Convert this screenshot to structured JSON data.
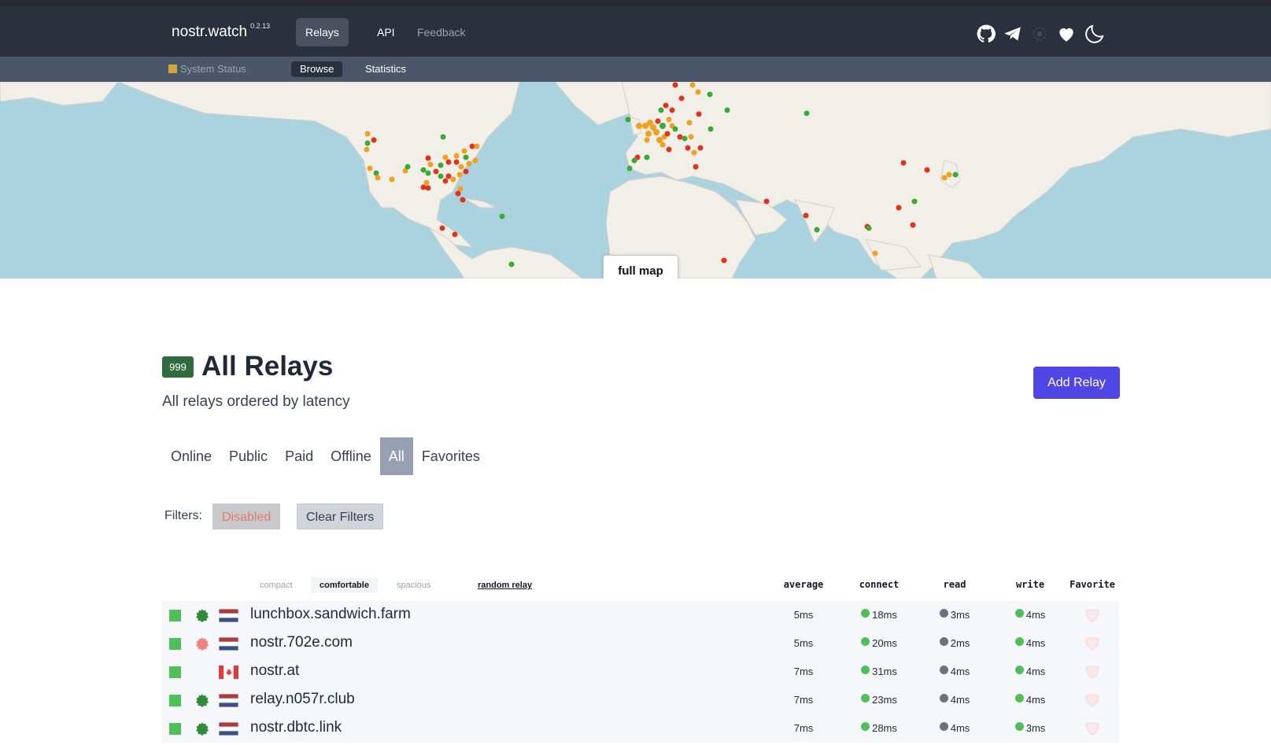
{
  "nav": {
    "brand": "nostr.watch",
    "version": "0.2.13",
    "items": [
      {
        "label": "Relays",
        "active": true
      },
      {
        "label": "API",
        "active": false
      },
      {
        "label": "Feedback",
        "active": false
      }
    ],
    "icons": [
      "github-icon",
      "telegram-icon",
      "nostr-icon",
      "heart-icon",
      "moon-icon"
    ]
  },
  "subnav": {
    "status": "System Status",
    "browse": "Browse",
    "statistics": "Statistics"
  },
  "map": {
    "button": "full map"
  },
  "header": {
    "count": "999",
    "title": "All Relays",
    "subtitle": "All relays ordered by latency",
    "add_button": "Add Relay"
  },
  "tabs": [
    {
      "label": "Online",
      "active": false
    },
    {
      "label": "Public",
      "active": false
    },
    {
      "label": "Paid",
      "active": false
    },
    {
      "label": "Offline",
      "active": false
    },
    {
      "label": "All",
      "active": true
    },
    {
      "label": "Favorites",
      "active": false
    }
  ],
  "filters": {
    "label": "Filters:",
    "disabled": "Disabled",
    "clear": "Clear Filters"
  },
  "table": {
    "density": [
      "compact",
      "comfortable",
      "spacious"
    ],
    "density_active": "comfortable",
    "random": "random relay",
    "columns": [
      "average",
      "connect",
      "read",
      "write",
      "Favorite"
    ],
    "rows": [
      {
        "name": "lunchbox.sandwich.farm",
        "seal": "green",
        "flag": "nl",
        "average": "5ms",
        "connect": "18ms",
        "read": "3ms",
        "write": "4ms"
      },
      {
        "name": "nostr.702e.com",
        "seal": "red",
        "flag": "nl",
        "average": "5ms",
        "connect": "20ms",
        "read": "2ms",
        "write": "4ms"
      },
      {
        "name": "nostr.at",
        "seal": "none",
        "flag": "ca",
        "average": "7ms",
        "connect": "31ms",
        "read": "4ms",
        "write": "4ms"
      },
      {
        "name": "relay.n057r.club",
        "seal": "green",
        "flag": "nl",
        "average": "7ms",
        "connect": "23ms",
        "read": "4ms",
        "write": "4ms"
      },
      {
        "name": "nostr.dbtc.link",
        "seal": "green",
        "flag": "nl",
        "average": "7ms",
        "connect": "28ms",
        "read": "4ms",
        "write": "3ms"
      }
    ]
  },
  "colors": {
    "nav_bg": "#2b303d",
    "subnav_bg": "#4c5669",
    "accent": "#4f46e5",
    "online": "#4fbf5a",
    "marker_red": "#e3321c",
    "marker_orange": "#f0a020",
    "marker_green": "#3aaa35"
  }
}
